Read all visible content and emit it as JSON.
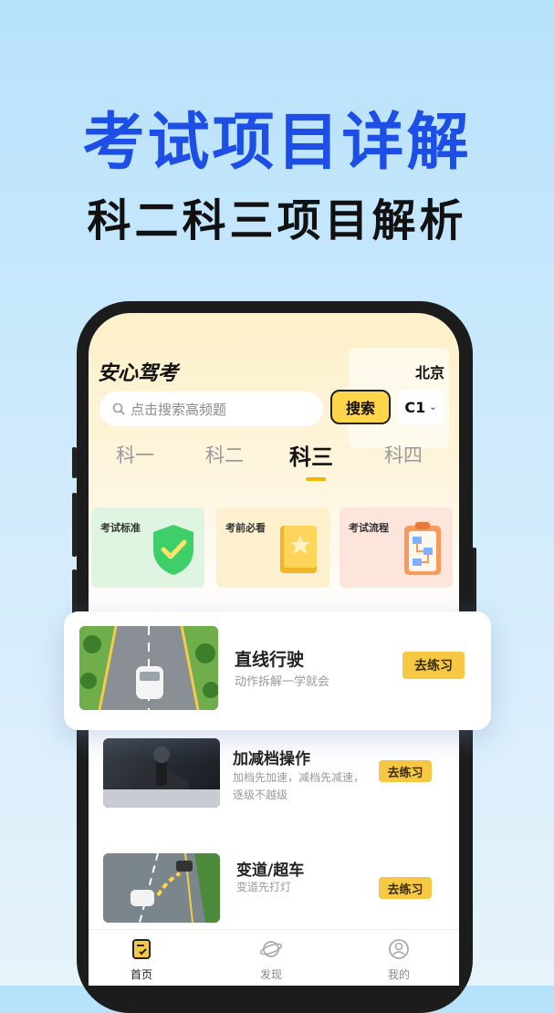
{
  "promo": {
    "headline": "考试项目详解",
    "subheadline": "科二科三项目解析"
  },
  "app": {
    "logo": "安心驾考",
    "city": "北京",
    "search_placeholder": "点击搜索高频题",
    "search_button": "搜索",
    "license_type": "C1"
  },
  "tabs": [
    {
      "label": "科一",
      "active": false
    },
    {
      "label": "科二",
      "active": false
    },
    {
      "label": "科三",
      "active": true
    },
    {
      "label": "科四",
      "active": false
    }
  ],
  "features": [
    {
      "label": "考试标准",
      "icon": "shield-check-icon"
    },
    {
      "label": "考前必看",
      "icon": "book-star-icon"
    },
    {
      "label": "考试流程",
      "icon": "clipboard-flow-icon"
    }
  ],
  "lessons": [
    {
      "title": "直线行驶",
      "desc": "动作拆解一学就会",
      "button": "去练习",
      "thumb": "straight-road-image"
    },
    {
      "title": "加减档操作",
      "desc": "加档先加速，减档先减速，逐级不越级",
      "desc_line1": "加档先加速，减档先减速，",
      "desc_line2": "逐级不越级",
      "button": "去练习",
      "thumb": "gear-shift-image"
    },
    {
      "title": "变道/超车",
      "desc": "变道先打灯",
      "button": "去练习",
      "thumb": "lane-change-image"
    }
  ],
  "bottom_nav": [
    {
      "label": "首页",
      "active": true,
      "icon": "home-doc-icon"
    },
    {
      "label": "发现",
      "active": false,
      "icon": "planet-icon"
    },
    {
      "label": "我的",
      "active": false,
      "icon": "user-icon"
    }
  ],
  "colors": {
    "headline_blue": "#1d4fe6",
    "accent_yellow": "#f6c843"
  }
}
